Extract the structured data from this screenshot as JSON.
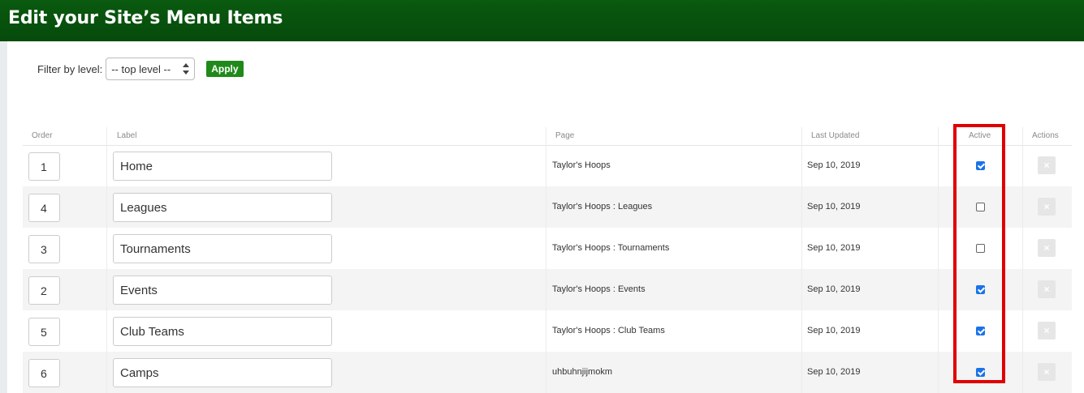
{
  "header": {
    "title": "Edit your Site’s Menu Items"
  },
  "filter": {
    "label": "Filter by level:",
    "selected": "-- top level --",
    "apply_label": "Apply"
  },
  "table": {
    "columns": [
      "Order",
      "Label",
      "Page",
      "Last Updated",
      "Active",
      "Actions"
    ],
    "rows": [
      {
        "order": "1",
        "label": "Home",
        "page": "Taylor's Hoops",
        "updated": "Sep 10, 2019",
        "active": true,
        "delete": "×"
      },
      {
        "order": "4",
        "label": "Leagues",
        "page": "Taylor's Hoops : Leagues",
        "updated": "Sep 10, 2019",
        "active": false,
        "delete": "×"
      },
      {
        "order": "3",
        "label": "Tournaments",
        "page": "Taylor's Hoops : Tournaments",
        "updated": "Sep 10, 2019",
        "active": false,
        "delete": "×"
      },
      {
        "order": "2",
        "label": "Events",
        "page": "Taylor's Hoops : Events",
        "updated": "Sep 10, 2019",
        "active": true,
        "delete": "×"
      },
      {
        "order": "5",
        "label": "Club Teams",
        "page": "Taylor's Hoops : Club Teams",
        "updated": "Sep 10, 2019",
        "active": true,
        "delete": "×"
      },
      {
        "order": "6",
        "label": "Camps",
        "page": "uhbuhnjijmokm",
        "updated": "Sep 10, 2019",
        "active": true,
        "delete": "×"
      }
    ]
  },
  "colors": {
    "header_bg": "#064a0b",
    "apply_bg": "#1f8a1a",
    "highlight": "#e00000",
    "checkbox": "#1a73e8"
  }
}
